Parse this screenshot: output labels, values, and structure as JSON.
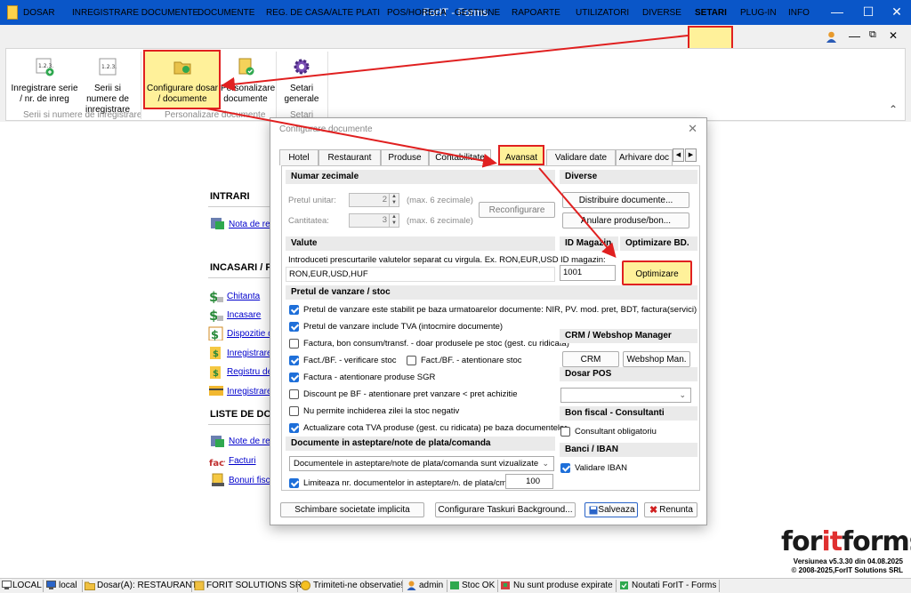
{
  "window": {
    "title": "ForIT - Forms",
    "minimize_glyph": "—",
    "maximize_glyph": "☐",
    "close_glyph": "✕"
  },
  "menu": {
    "items": [
      "DOSAR",
      "INREGISTRARE DOCUMENTE",
      "DOCUMENTE",
      "REG. DE CASA/ALTE PLATI",
      "POS/HORECA",
      "GESTIUNE",
      "RAPOARTE",
      "UTILIZATORI",
      "DIVERSE",
      "SETARI",
      "PLUG-IN",
      "INFO"
    ],
    "active": "SETARI",
    "right_controls": [
      "user-icon",
      "minimize",
      "restore",
      "close"
    ]
  },
  "ribbon": {
    "buttons": [
      {
        "label": "Inregistrare serie / nr. de inreg",
        "icon": "numbering-add-icon"
      },
      {
        "label": "Serii si numere de inregistrare",
        "icon": "numbering-icon"
      },
      {
        "label": "Configurare dosar / documente",
        "icon": "folder-config-icon"
      },
      {
        "label": "Personalizare documente",
        "icon": "document-check-icon"
      },
      {
        "label": "Setari generale",
        "icon": "gear-icon"
      }
    ],
    "groups": [
      "Serii si numere de inregistrare",
      "Personalizare documente",
      "Setari"
    ],
    "collapse_glyph": "⌃"
  },
  "main": {
    "sections": [
      {
        "title": "INTRARI",
        "links": [
          "Nota de rec"
        ]
      },
      {
        "title": "INCASARI / P",
        "links": [
          "Chitanta",
          "Incasare",
          "Dispozitie de",
          "Inregistrare",
          "Registru de",
          "Inregistrare"
        ]
      },
      {
        "title": "LISTE DE DOC",
        "links": [
          "Note de rec",
          "Facturi",
          "Bonuri fisca"
        ]
      }
    ]
  },
  "dialog": {
    "title": "Configurare documente",
    "close_glyph": "✕",
    "tabs": [
      "Hotel",
      "Restaurant",
      "Produse",
      "Contabilitate",
      "Avansat",
      "Validare date",
      "Arhivare doc"
    ],
    "active_tab": "Avansat",
    "tab_nav": [
      "◀",
      "▶"
    ],
    "numar_zecimale": {
      "header": "Numar zecimale",
      "pret_unitar_label": "Pretul unitar:",
      "pret_unitar_value": "2",
      "pret_unitar_hint": "(max. 6 zecimale)",
      "cantitatea_label": "Cantitatea:",
      "cantitatea_value": "3",
      "cantitatea_hint": "(max. 6 zecimale)",
      "reconfigurare": "Reconfigurare"
    },
    "valute": {
      "header": "Valute",
      "instructions": "Introduceti prescurtarile valutelor separat cu virgula. Ex. RON,EUR,USD",
      "value": "RON,EUR,USD,HUF"
    },
    "diverse": {
      "header": "Diverse",
      "distribuire": "Distribuire documente...",
      "anulare": "Anulare produse/bon..."
    },
    "id_magazin": {
      "header": "ID Magazin",
      "label": "ID magazin:",
      "value": "1001"
    },
    "optimizare": {
      "header": "Optimizare BD.",
      "button": "Optimizare"
    },
    "pretul": {
      "header": "Pretul de vanzare / stoc",
      "options": [
        {
          "label": "Pretul de vanzare este stabilit pe baza urmatoarelor documente: NIR, PV. mod. pret, BDT, factura(servici)",
          "checked": true
        },
        {
          "label": "Pretul de vanzare include TVA (intocmire documente)",
          "checked": true
        },
        {
          "label": "Factura, bon consum/transf. - doar produsele pe stoc (gest. cu ridicata)",
          "checked": false
        },
        {
          "label": "Fact./BF. - verificare stoc",
          "checked": true
        },
        {
          "label": "Fact./BF. - atentionare stoc",
          "checked": false
        },
        {
          "label": "Factura - atentionare produse SGR",
          "checked": true
        },
        {
          "label": "Discount pe BF - atentionare pret vanzare < pret achizitie",
          "checked": false
        },
        {
          "label": "Nu permite inchiderea zilei la stoc negativ",
          "checked": false
        },
        {
          "label": "Actualizare cota TVA produse (gest. cu ridicata) pe baza documentelor",
          "checked": true
        }
      ]
    },
    "crm": {
      "header": "CRM / Webshop Manager",
      "crm_button": "CRM",
      "webshop_button": "Webshop Man."
    },
    "dosar_pos": {
      "header": "Dosar POS",
      "value": ""
    },
    "bon_fiscal": {
      "header": "Bon fiscal - Consultanti",
      "option": {
        "label": "Consultant obligatoriu",
        "checked": false
      }
    },
    "banci": {
      "header": "Banci / IBAN",
      "option": {
        "label": "Validare IBAN",
        "checked": true
      }
    },
    "documente_asteptare": {
      "header": "Documente in asteptare/note de plata/comanda",
      "select_value": "Documentele in asteptare/note de plata/comanda sunt vizualizate",
      "limit_label": "Limiteaza nr. documentelor in asteptare/n. de plata/cmd:",
      "limit_checked": true,
      "limit_value": "100"
    },
    "footer": {
      "schimbare": "Schimbare societate implicita",
      "configurare_taskuri": "Configurare Taskuri Background...",
      "salveaza": "Salveaza",
      "renunta": "Renunta"
    }
  },
  "branding": {
    "logo_part1": "for",
    "logo_part2": "it",
    "logo_part3": "forms",
    "version": "Versiunea v5.3.30 din 04.08.2025",
    "copyright": "© 2008-2025,ForIT Solutions SRL"
  },
  "statusbar": {
    "items": [
      "LOCAL",
      "local",
      "Dosar(A): RESTAURANT",
      "FORIT SOLUTIONS SRL",
      "Trimiteti-ne observatie!",
      "admin",
      "Stoc OK",
      "Nu sunt produse expirate",
      "Noutati ForIT - Forms"
    ]
  },
  "colors": {
    "titlebar": "#0a56c8",
    "highlight_fill": "#fff19a",
    "highlight_border": "#e02020",
    "checkbox_accent": "#1e6fd9",
    "link": "#0000cc"
  }
}
